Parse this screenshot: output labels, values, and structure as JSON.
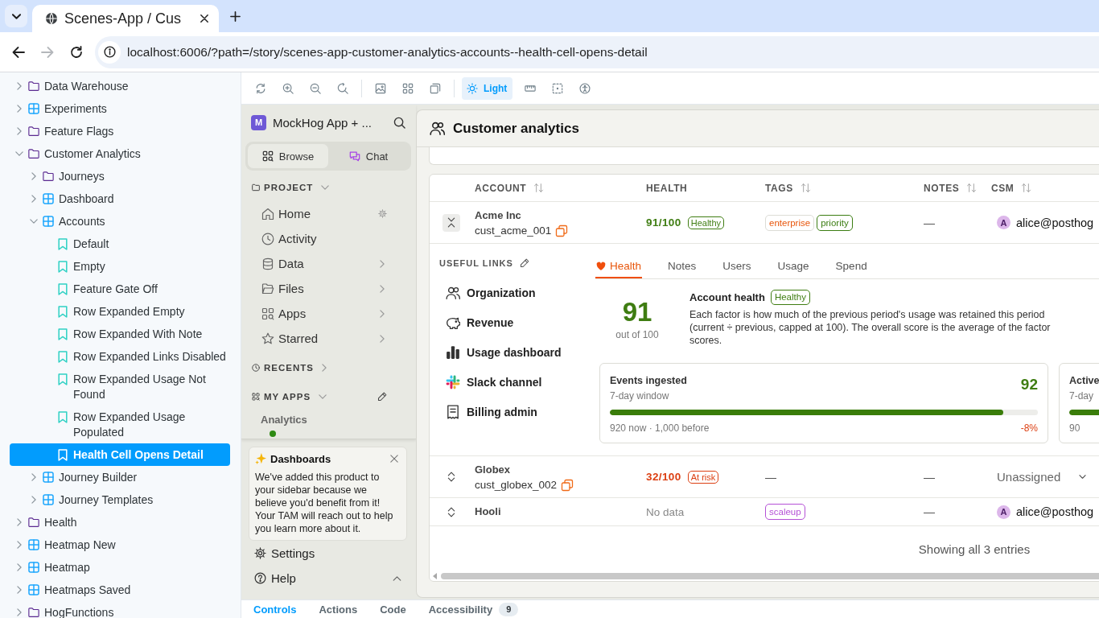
{
  "browser": {
    "tab_title": "Scenes-App / Cus",
    "url": "localhost:6006/?path=/story/scenes-app-customer-analytics-accounts--health-cell-opens-detail",
    "nav": [
      {
        "kind": "back",
        "disabled": false
      },
      {
        "kind": "forward",
        "disabled": true
      },
      {
        "kind": "reload",
        "disabled": false
      }
    ]
  },
  "storybook_sidebar": {
    "items": [
      {
        "label": "Data Warehouse",
        "kind": "folder",
        "expanded": false,
        "selected": false
      },
      {
        "label": "Experiments",
        "kind": "component",
        "expanded": false,
        "selected": false
      },
      {
        "label": "Feature Flags",
        "kind": "folder",
        "expanded": false,
        "selected": false
      },
      {
        "label": "Customer Analytics",
        "kind": "folder",
        "expanded": true,
        "selected": false,
        "children": [
          {
            "label": "Journeys",
            "kind": "folder",
            "expanded": false,
            "selected": false
          },
          {
            "label": "Dashboard",
            "kind": "component",
            "expanded": false,
            "selected": false
          },
          {
            "label": "Accounts",
            "kind": "component",
            "expanded": true,
            "selected": false,
            "children": [
              {
                "label": "Default",
                "kind": "story",
                "selected": false
              },
              {
                "label": "Empty",
                "kind": "story",
                "selected": false
              },
              {
                "label": "Feature Gate Off",
                "kind": "story",
                "selected": false
              },
              {
                "label": "Row Expanded Empty",
                "kind": "story",
                "selected": false
              },
              {
                "label": "Row Expanded With Note",
                "kind": "story",
                "selected": false
              },
              {
                "label": "Row Expanded Links Disabled",
                "kind": "story",
                "selected": false
              },
              {
                "label": "Row Expanded Usage Not Found",
                "kind": "story",
                "selected": false
              },
              {
                "label": "Row Expanded Usage Populated",
                "kind": "story",
                "selected": false
              },
              {
                "label": "Health Cell Opens Detail",
                "kind": "story",
                "selected": true
              }
            ]
          },
          {
            "label": "Journey Builder",
            "kind": "component",
            "expanded": false,
            "selected": false
          },
          {
            "label": "Journey Templates",
            "kind": "component",
            "expanded": false,
            "selected": false
          }
        ]
      },
      {
        "label": "Health",
        "kind": "folder",
        "expanded": false,
        "selected": false
      },
      {
        "label": "Heatmap New",
        "kind": "component",
        "expanded": false,
        "selected": false
      },
      {
        "label": "Heatmap",
        "kind": "component",
        "expanded": false,
        "selected": false
      },
      {
        "label": "Heatmaps Saved",
        "kind": "component",
        "expanded": false,
        "selected": false
      },
      {
        "label": "HogFunctions",
        "kind": "folder",
        "expanded": false,
        "selected": false
      }
    ]
  },
  "storybook_toolbar": {
    "theme_button": {
      "label": "Light",
      "selected": true
    }
  },
  "app_sidebar": {
    "avatar": "M",
    "project": "MockHog App + ...",
    "modes": [
      {
        "label": "Browse",
        "selected": true
      },
      {
        "label": "Chat",
        "selected": false
      }
    ],
    "sections": [
      {
        "label": "PROJECT",
        "expanded": true,
        "editable": false,
        "items": [
          {
            "label": "Home",
            "has_submenu": false,
            "has_settings": true
          },
          {
            "label": "Activity",
            "has_submenu": false,
            "has_settings": false
          },
          {
            "label": "Data",
            "has_submenu": true,
            "has_settings": false
          },
          {
            "label": "Files",
            "has_submenu": true,
            "has_settings": false
          },
          {
            "label": "Apps",
            "has_submenu": true,
            "has_settings": false
          },
          {
            "label": "Starred",
            "has_submenu": true,
            "has_settings": false
          }
        ]
      },
      {
        "label": "RECENTS",
        "expanded": false,
        "editable": false
      },
      {
        "label": "MY APPS",
        "expanded": true,
        "editable": true,
        "groups": [
          {
            "label": "Analytics"
          }
        ]
      }
    ],
    "notice": {
      "title": "Dashboards",
      "body": "We've added this product to your sidebar because we believe you'd benefit from it! Your TAM will reach out to help you learn more about it."
    },
    "footer": [
      {
        "label": "Settings",
        "has_menu": false
      },
      {
        "label": "Help",
        "has_menu": true
      }
    ]
  },
  "main": {
    "title": "Customer analytics",
    "table": {
      "columns": [
        {
          "label": "ACCOUNT",
          "sortable": true
        },
        {
          "label": "HEALTH",
          "sortable": false
        },
        {
          "label": "TAGS",
          "sortable": true
        },
        {
          "label": "NOTES",
          "sortable": true
        },
        {
          "label": "CSM",
          "sortable": true
        }
      ],
      "rows": [
        {
          "name": "Acme Inc",
          "account_id": "cust_acme_001",
          "expanded": true,
          "health": {
            "kind": "healthy",
            "score": "91/100",
            "badge": "Healthy"
          },
          "tags": [
            {
              "label": "enterprise",
              "color": "#e8560c",
              "bordered": false
            },
            {
              "label": "priority",
              "color": "#3b7d12",
              "bordered": true
            }
          ],
          "notes": "—",
          "csm": {
            "kind": "user",
            "avatar": "A",
            "email": "alice@posthog"
          },
          "detail": {
            "links_title": "USEFUL LINKS",
            "links": [
              {
                "label": "Organization"
              },
              {
                "label": "Revenue"
              },
              {
                "label": "Usage dashboard"
              },
              {
                "label": "Slack channel"
              },
              {
                "label": "Billing admin"
              }
            ],
            "tabs": [
              {
                "label": "Health",
                "selected": true
              },
              {
                "label": "Notes",
                "selected": false
              },
              {
                "label": "Users",
                "selected": false
              },
              {
                "label": "Usage",
                "selected": false
              },
              {
                "label": "Spend",
                "selected": false
              }
            ],
            "score": "91",
            "score_caption": "out of 100",
            "heading": "Account health",
            "badge": "Healthy",
            "description": "Each factor is how much of the previous period's usage was retained this period (current ÷ previous, capped at 100). The overall score is the average of the factor scores.",
            "factors": [
              {
                "title": "Events ingested",
                "subtitle": "7-day window",
                "score": "92",
                "level": 0.92,
                "summary": "920 now · 1,000 before",
                "change": "-8%"
              },
              {
                "title": "Active",
                "subtitle": "7-day",
                "level": 0.9,
                "summary": "90"
              }
            ]
          }
        },
        {
          "name": "Globex",
          "account_id": "cust_globex_002",
          "expanded": false,
          "health": {
            "kind": "at_risk",
            "score": "32/100",
            "badge": "At risk"
          },
          "tags_text": "—",
          "notes": "—",
          "csm": {
            "kind": "unassigned",
            "label": "Unassigned"
          }
        },
        {
          "name": "Hooli",
          "expanded": false,
          "health": {
            "kind": "no_data",
            "score": "No data"
          },
          "tags": [
            {
              "label": "scaleup",
              "color": "#b550d6",
              "bordered": true
            }
          ],
          "notes": "—",
          "csm": {
            "kind": "user",
            "avatar": "A",
            "email": "alice@posthog"
          }
        }
      ],
      "footer": "Showing all 3 entries"
    }
  },
  "addon_panel": {
    "tabs": [
      {
        "label": "Controls",
        "selected": true
      },
      {
        "label": "Actions",
        "selected": false
      },
      {
        "label": "Code",
        "selected": false
      },
      {
        "label": "Accessibility",
        "selected": false,
        "badge": "9"
      }
    ]
  }
}
